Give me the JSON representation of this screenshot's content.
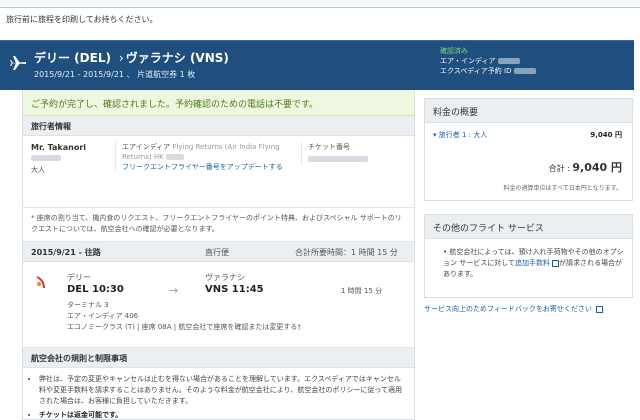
{
  "top_note": "旅行前に旅程を印刷してお持ちください。",
  "banner": {
    "origin": "デリー (DEL)",
    "arrow": "›",
    "destination": "ヴァラナシ (VNS)",
    "dates": "2015/9/21 - 2015/9/21 、 片道航空券 1 枚",
    "status": "確認済み",
    "airline_conf": "エア・インディア",
    "expedia_conf": "エクスペディア予約 ID"
  },
  "success_msg": "ご予約が完了し、確認されました。予約確認のための電話は不要です。",
  "traveler": {
    "section": "旅行者情報",
    "name": "Mr. Takanori",
    "type": "大人",
    "program": "エアインディア",
    "program_grey": "Flying Returns (Air India Flying Returns) HK",
    "upgrade_link": "フリークエントフライヤー番号をアップデートする",
    "ticket_label": "チケット番号"
  },
  "request_note": "* 座席の割り当て、機内食のリクエスト、フリークエントフライヤーのポイント特典、およびスペシャル サポートのリクエストについては、航空会社への確認が必要となります。",
  "leg": {
    "date": "2015/9/21 - 往路",
    "type": "直行便",
    "total_time": "合計所要時間：1 時間 15 分"
  },
  "flight": {
    "from_city": "デリー",
    "dep": "DEL 10:30",
    "to_city": "ヴァラナシ",
    "arr": "VNS 11:45",
    "duration": "1 時間 15 分",
    "terminal": "ターミナル 3",
    "airline": "エア・インディア 406",
    "cabin": "エコノミークラス (T) | 座席 08A | 航空会社で座席を確認または変更する†"
  },
  "rules": {
    "section": "航空会社の規則と制限事項",
    "item1": "弊社は、予定の変更やキャンセルは止むを得ない場合があることを理解しています。エクスペディアではキャンセル料や変更手数料を請求することはありません。そのような料金が航空会社により、航空会社のポリシーに従って適用された場合は、お客様に負担していただきます。",
    "item2": "チケットは返金可能です。"
  },
  "price": {
    "section": "料金の概要",
    "traveler_line": "旅行者 1 : 大人",
    "traveler_amount": "9,040 円",
    "total_label": "合計 :",
    "total_amount": "9,040 円",
    "currency_note": "料金の適算単位はすべて日本円となります。"
  },
  "other": {
    "section": "その他のフライト サービス",
    "text_before": "航空会社によっては、預け入れ手荷物やその他のオプション サービスに対して",
    "link": "追加手数料",
    "text_after": "が請求される場合があります。"
  },
  "feedback": "サービス向上のためフィードバックをお寄せください",
  "colors": {
    "banner": "#1f4f7f",
    "success_bg": "#eef7df",
    "link": "#1a5fb4"
  }
}
